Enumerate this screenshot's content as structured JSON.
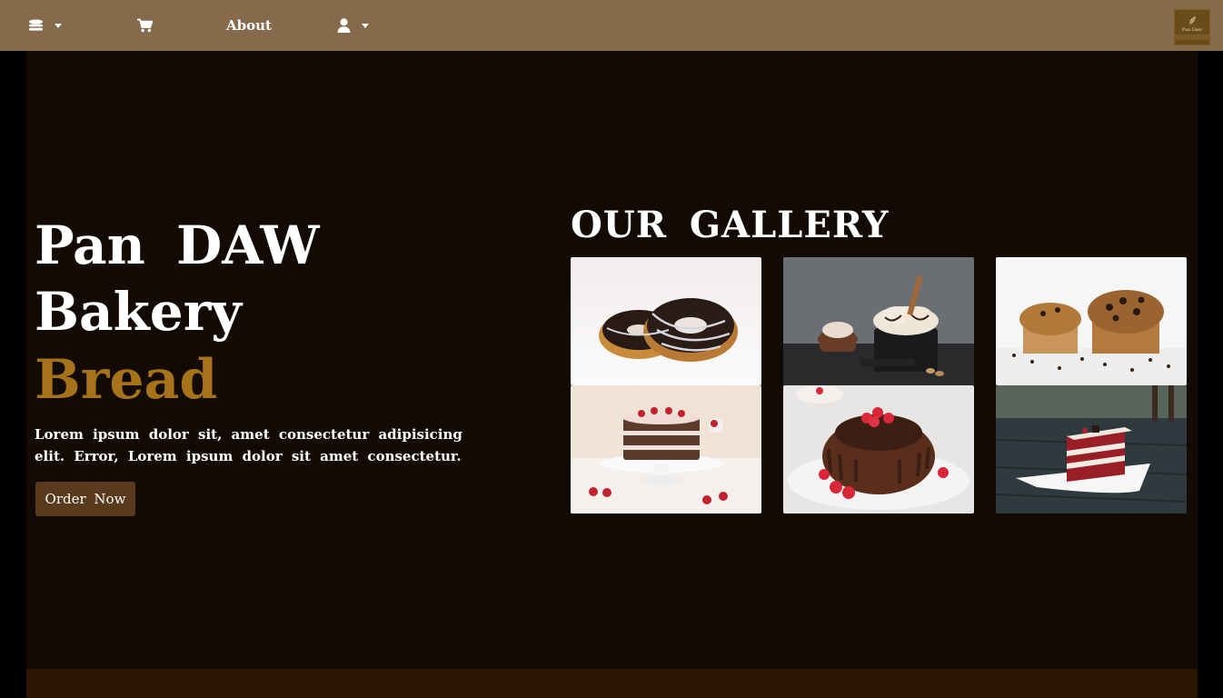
{
  "navbar": {
    "about_label": "About",
    "menu_icon": "stack-icon",
    "cart_icon": "cart-icon",
    "user_icon": "user-icon",
    "logo_text": "Pan Daw"
  },
  "hero": {
    "title": "Pan DAW Bakery",
    "subtitle": "Bread",
    "description": "Lorem ipsum dolor sit, amet consectetur adipisicing elit. Error, Lorem ipsum dolor sit amet consectetur.",
    "order_button": "Order Now"
  },
  "gallery": {
    "title": "OUR GALLERY",
    "images": [
      {
        "subject": "chocolate glazed donuts"
      },
      {
        "subject": "ice cream with chocolate"
      },
      {
        "subject": "chocolate chip muffins"
      },
      {
        "subject": "strawberry layer cake"
      },
      {
        "subject": "chocolate bundt cake with raspberries"
      },
      {
        "subject": "red velvet cake slice"
      }
    ]
  },
  "colors": {
    "navbar": "#856a4c",
    "background": "#120a03",
    "accent": "#a6721a",
    "button": "#5a3a1c",
    "footer": "#2b1604"
  }
}
